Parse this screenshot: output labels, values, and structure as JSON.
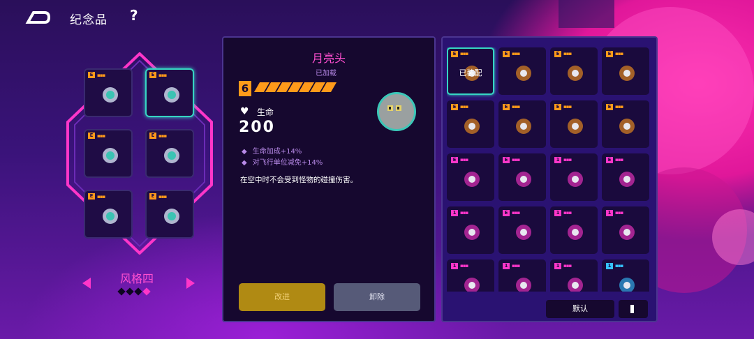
{
  "header": {
    "title": "纪念品",
    "help": "?"
  },
  "style": {
    "name": "风格四",
    "dots": 4,
    "active_dot": 3
  },
  "left_slots": [
    {
      "tag": "E",
      "pips": "▪▪▪",
      "icon": "blaster-icon"
    },
    {
      "tag": "E",
      "pips": "▪▪▪",
      "icon": "moon-head-icon",
      "selected": true
    },
    {
      "tag": "E",
      "pips": "▪▪▪",
      "icon": "battery-icon"
    },
    {
      "tag": "E",
      "pips": "▪▪▪",
      "icon": "sunburst-icon"
    },
    {
      "tag": "E",
      "pips": "▪▪▪",
      "icon": "photo-card-icon"
    },
    {
      "tag": "E",
      "pips": "▪▪▪",
      "icon": "horse-head-icon"
    }
  ],
  "detail": {
    "name": "月亮头",
    "status": "已加载",
    "grade": "6",
    "stars": 7,
    "stat_label": "生命",
    "stat_value": "200",
    "bonuses": [
      "生命加成+14%",
      "对飞行单位减免+14%"
    ],
    "description": "在空中时不会受到怪物的碰撞伤害。",
    "upgrade_label": "改进",
    "remove_label": "卸除"
  },
  "inventory": {
    "items": [
      {
        "tag": "E",
        "color": "#ff9a1a",
        "icon": "moon-head-icon",
        "equipped": "已装配"
      },
      {
        "tag": "E",
        "color": "#ff9a1a",
        "icon": "flame-mask-icon"
      },
      {
        "tag": "E",
        "color": "#ff9a1a",
        "icon": "cog-orb-icon"
      },
      {
        "tag": "E",
        "color": "#ff9a1a",
        "icon": "banana-icon"
      },
      {
        "tag": "E",
        "color": "#ff9a1a",
        "icon": "cat-card-icon"
      },
      {
        "tag": "E",
        "color": "#ff9a1a",
        "icon": "skull-mask-icon"
      },
      {
        "tag": "E",
        "color": "#ff9a1a",
        "icon": "blue-gem-icon"
      },
      {
        "tag": "E",
        "color": "#ff9a1a",
        "icon": "target-orb-icon"
      },
      {
        "tag": "E",
        "color": "#ff36c9",
        "icon": "treasure-box-icon"
      },
      {
        "tag": "E",
        "color": "#ff36c9",
        "icon": "demon-face-icon"
      },
      {
        "tag": "1",
        "color": "#ff36c9",
        "icon": "acorn-icon"
      },
      {
        "tag": "E",
        "color": "#ff36c9",
        "icon": "panda-icon"
      },
      {
        "tag": "1",
        "color": "#ff36c9",
        "icon": "berries-icon"
      },
      {
        "tag": "E",
        "color": "#ff36c9",
        "icon": "card-icon"
      },
      {
        "tag": "1",
        "color": "#ff36c9",
        "icon": "crate-icon"
      },
      {
        "tag": "1",
        "color": "#ff36c9",
        "icon": "cyan-orb-icon"
      },
      {
        "tag": "1",
        "color": "#ff36c9",
        "icon": "hooded-figure-icon"
      },
      {
        "tag": "1",
        "color": "#ff36c9",
        "icon": "bowl-icon"
      },
      {
        "tag": "1",
        "color": "#ff36c9",
        "icon": "bandage-icon"
      },
      {
        "tag": "1",
        "color": "#36c2ff",
        "icon": "money-bag-icon"
      }
    ],
    "default_label": "默认"
  }
}
